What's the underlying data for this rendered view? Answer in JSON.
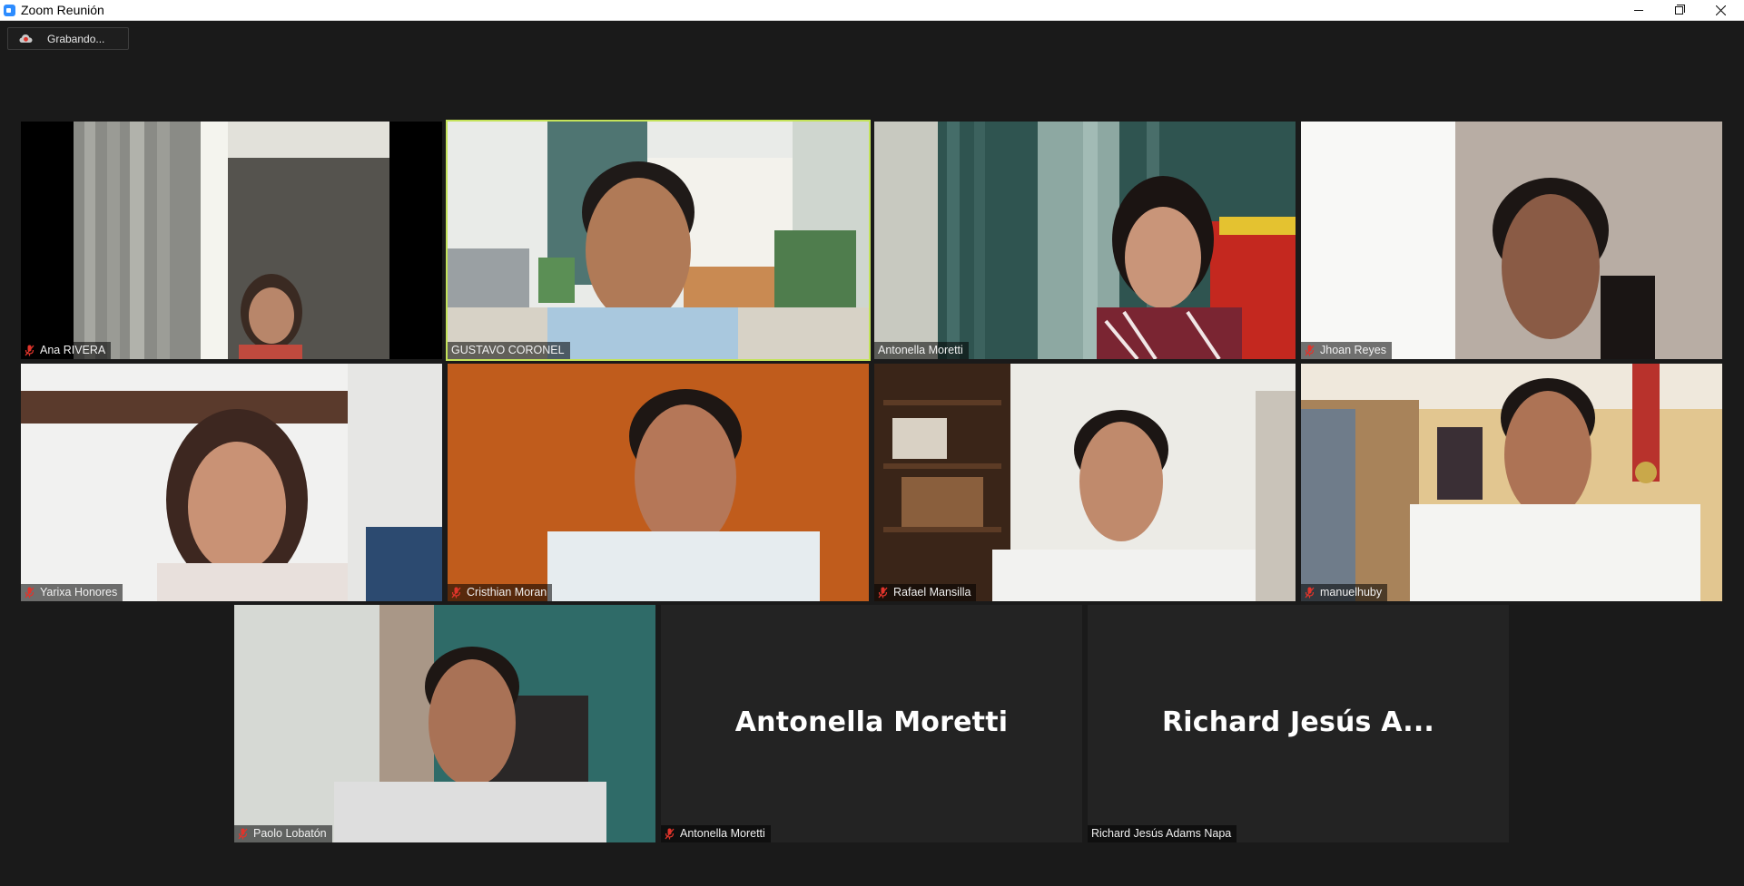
{
  "window": {
    "title": "Zoom Reunión",
    "minimize": "minimize",
    "maximize": "restore",
    "close": "close"
  },
  "recording": {
    "label": "Grabando..."
  },
  "participants": [
    {
      "name": "Ana RIVERA",
      "muted": true,
      "video": true,
      "active": false
    },
    {
      "name": "GUSTAVO CORONEL",
      "muted": false,
      "video": true,
      "active": true
    },
    {
      "name": "Antonella Moretti",
      "muted": false,
      "video": true,
      "active": false
    },
    {
      "name": "Jhoan Reyes",
      "muted": true,
      "video": true,
      "active": false
    },
    {
      "name": "Yarixa Honores",
      "muted": true,
      "video": true,
      "active": false
    },
    {
      "name": "Cristhian Moran",
      "muted": true,
      "video": true,
      "active": false
    },
    {
      "name": "Rafael Mansilla",
      "muted": true,
      "video": true,
      "active": false
    },
    {
      "name": "manuelhuby",
      "muted": true,
      "video": true,
      "active": false
    },
    {
      "name": "Paolo Lobatón",
      "muted": true,
      "video": true,
      "active": false
    },
    {
      "name": "Antonella Moretti",
      "display_name": "Antonella Moretti",
      "muted": true,
      "video": false,
      "active": false
    },
    {
      "name": "Richard Jesús Adams Napa",
      "display_name": "Richard Jesús A...",
      "muted": false,
      "video": false,
      "active": false
    }
  ],
  "colors": {
    "background": "#1a1a1a",
    "active_speaker": "#c4e35a",
    "muted_icon": "#e0342b",
    "recording_icon": "#e0342b"
  }
}
